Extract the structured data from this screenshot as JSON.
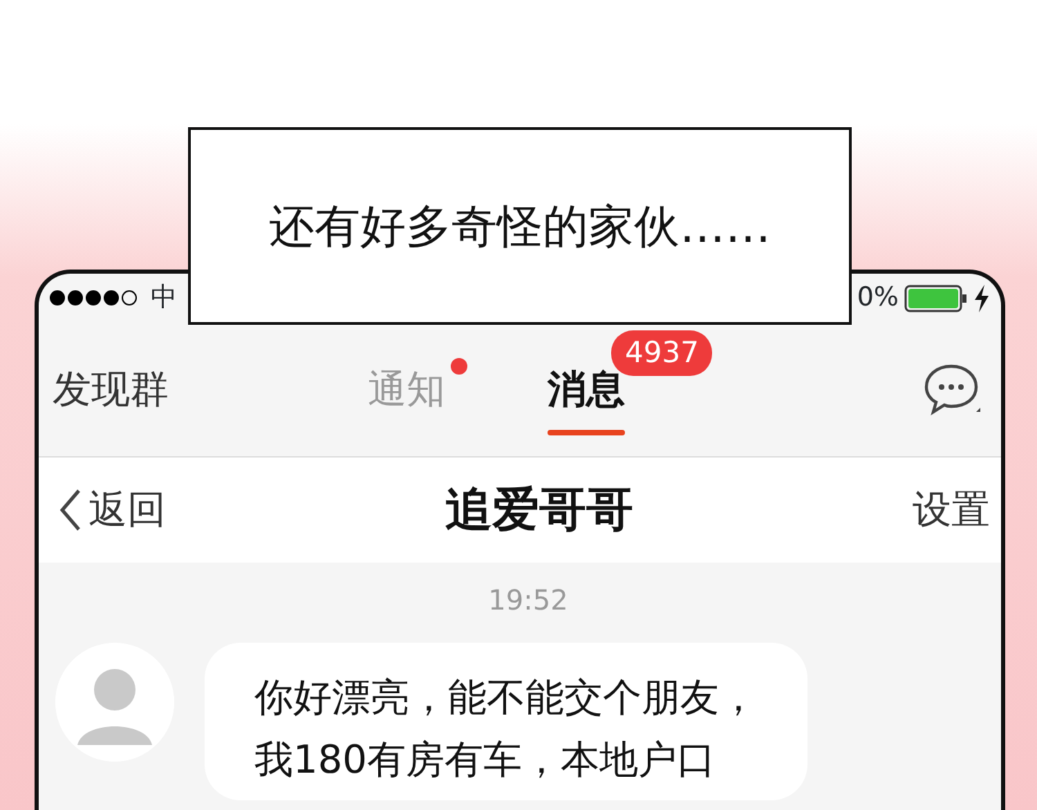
{
  "caption": "还有好多奇怪的家伙……",
  "status_bar": {
    "carrier": "中",
    "battery_text": "0%"
  },
  "tabs": [
    {
      "label": "发现群",
      "selected": false,
      "dot": false
    },
    {
      "label": "通知",
      "selected": false,
      "dot": true
    },
    {
      "label": "消息",
      "selected": true,
      "dot": false,
      "badge": "4937"
    }
  ],
  "nav": {
    "back": "返回",
    "title": "追爱哥哥",
    "settings": "设置"
  },
  "chat": {
    "time": "19:52",
    "messages": [
      {
        "lines": [
          "你好漂亮，能不能交个朋友，",
          "我180有房有车，本地户口"
        ]
      }
    ]
  }
}
